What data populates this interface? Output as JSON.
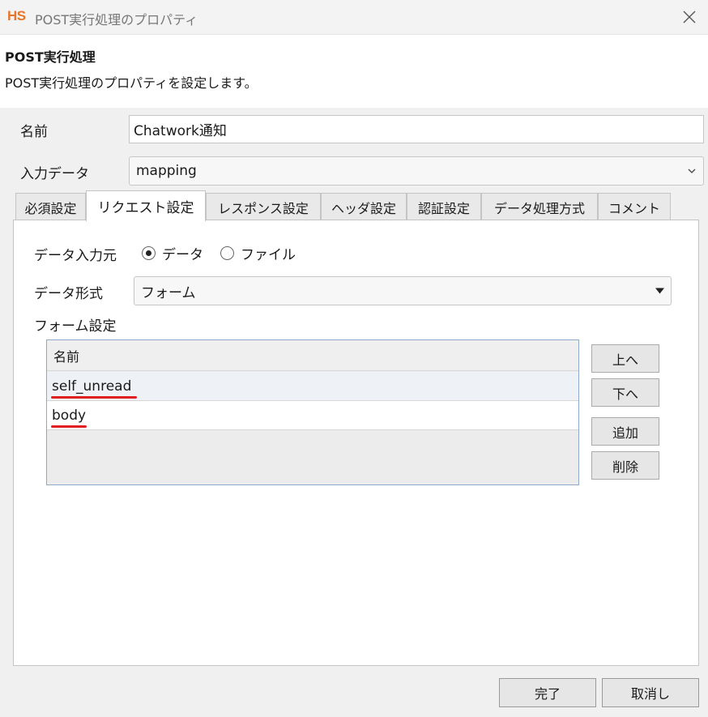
{
  "window": {
    "app_logo": "HS",
    "title": "POST実行処理のプロパティ"
  },
  "header": {
    "title": "POST実行処理",
    "description": "POST実行処理のプロパティを設定します。"
  },
  "form": {
    "name_label": "名前",
    "name_value": "Chatwork通知",
    "input_data_label": "入力データ",
    "input_data_value": "mapping"
  },
  "tabs": [
    {
      "label": "必須設定",
      "active": false
    },
    {
      "label": "リクエスト設定",
      "active": true
    },
    {
      "label": "レスポンス設定",
      "active": false
    },
    {
      "label": "ヘッダ設定",
      "active": false
    },
    {
      "label": "認証設定",
      "active": false
    },
    {
      "label": "データ処理方式",
      "active": false
    },
    {
      "label": "コメント",
      "active": false
    }
  ],
  "request": {
    "data_source_label": "データ入力元",
    "radio_data": "データ",
    "radio_file": "ファイル",
    "selected_source": "データ",
    "data_format_label": "データ形式",
    "data_format_value": "フォーム",
    "form_settings_label": "フォーム設定",
    "table_header": "名前",
    "rows": [
      "self_unread",
      "body"
    ],
    "buttons": {
      "up": "上へ",
      "down": "下へ",
      "add": "追加",
      "delete": "削除"
    }
  },
  "footer": {
    "finish": "完了",
    "cancel": "取消し"
  },
  "colors": {
    "logo": "#e8742a",
    "annotation_underline": "#e02020",
    "table_border": "#8eaacb"
  },
  "icons": {
    "close": "close-icon",
    "combo_chevron": "chevron-down-icon",
    "select_triangle": "triangle-down-icon"
  }
}
